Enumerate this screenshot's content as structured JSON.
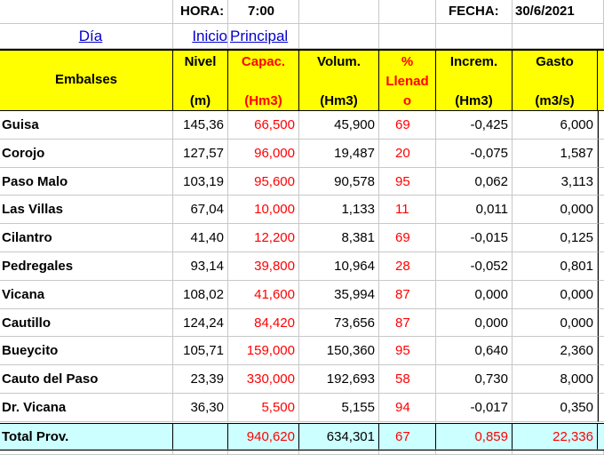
{
  "top": {
    "hora_label": "HORA:",
    "hora_value": "7:00",
    "fecha_label": "FECHA:",
    "fecha_value": "30/6/2021"
  },
  "links": {
    "dia": "Día",
    "inicio": "Inicio",
    "principal": "Principal"
  },
  "headers": {
    "embalses": "Embalses",
    "nivel": "Nivel",
    "nivel_unit": "(m)",
    "capac": "Capac.",
    "capac_unit": "(Hm3)",
    "volum": "Volum.",
    "volum_unit": "(Hm3)",
    "llenado_1": "%",
    "llenado_2": "Llenad",
    "llenado_3": "o",
    "increm": "Increm.",
    "increm_unit": "(Hm3)",
    "gasto": "Gasto",
    "gasto_unit": "(m3/s)"
  },
  "rows": [
    {
      "name": "Guisa",
      "nivel": "145,36",
      "capac": "66,500",
      "volum": "45,900",
      "llenado": "69",
      "increm": "-0,425",
      "gasto": "6,000"
    },
    {
      "name": "Corojo",
      "nivel": "127,57",
      "capac": "96,000",
      "volum": "19,487",
      "llenado": "20",
      "increm": "-0,075",
      "gasto": "1,587"
    },
    {
      "name": "Paso Malo",
      "nivel": "103,19",
      "capac": "95,600",
      "volum": "90,578",
      "llenado": "95",
      "increm": "0,062",
      "gasto": "3,113"
    },
    {
      "name": "Las Villas",
      "nivel": "67,04",
      "capac": "10,000",
      "volum": "1,133",
      "llenado": "11",
      "increm": "0,011",
      "gasto": "0,000"
    },
    {
      "name": "Cilantro",
      "nivel": "41,40",
      "capac": "12,200",
      "volum": "8,381",
      "llenado": "69",
      "increm": "-0,015",
      "gasto": "0,125"
    },
    {
      "name": "Pedregales",
      "nivel": "93,14",
      "capac": "39,800",
      "volum": "10,964",
      "llenado": "28",
      "increm": "-0,052",
      "gasto": "0,801"
    },
    {
      "name": "Vicana",
      "nivel": "108,02",
      "capac": "41,600",
      "volum": "35,994",
      "llenado": "87",
      "increm": "0,000",
      "gasto": "0,000"
    },
    {
      "name": "Cautillo",
      "nivel": "124,24",
      "capac": "84,420",
      "volum": "73,656",
      "llenado": "87",
      "increm": "0,000",
      "gasto": "0,000"
    },
    {
      "name": "Bueycito",
      "nivel": "105,71",
      "capac": "159,000",
      "volum": "150,360",
      "llenado": "95",
      "increm": "0,640",
      "gasto": "2,360"
    },
    {
      "name": "Cauto del Paso",
      "nivel": "23,39",
      "capac": "330,000",
      "volum": "192,693",
      "llenado": "58",
      "increm": "0,730",
      "gasto": "8,000"
    },
    {
      "name": "Dr. Vicana",
      "nivel": "36,30",
      "capac": "5,500",
      "volum": "5,155",
      "llenado": "94",
      "increm": "-0,017",
      "gasto": "0,350"
    }
  ],
  "total": {
    "name": "Total Prov.",
    "capac": "940,620",
    "volum": "634,301",
    "llenado": "67",
    "increm": "0,859",
    "gasto": "22,336"
  },
  "colors": {
    "header_bg": "#ffff00",
    "total_bg": "#ccffff",
    "red_text": "#ff0000",
    "link_text": "#0000cc"
  }
}
